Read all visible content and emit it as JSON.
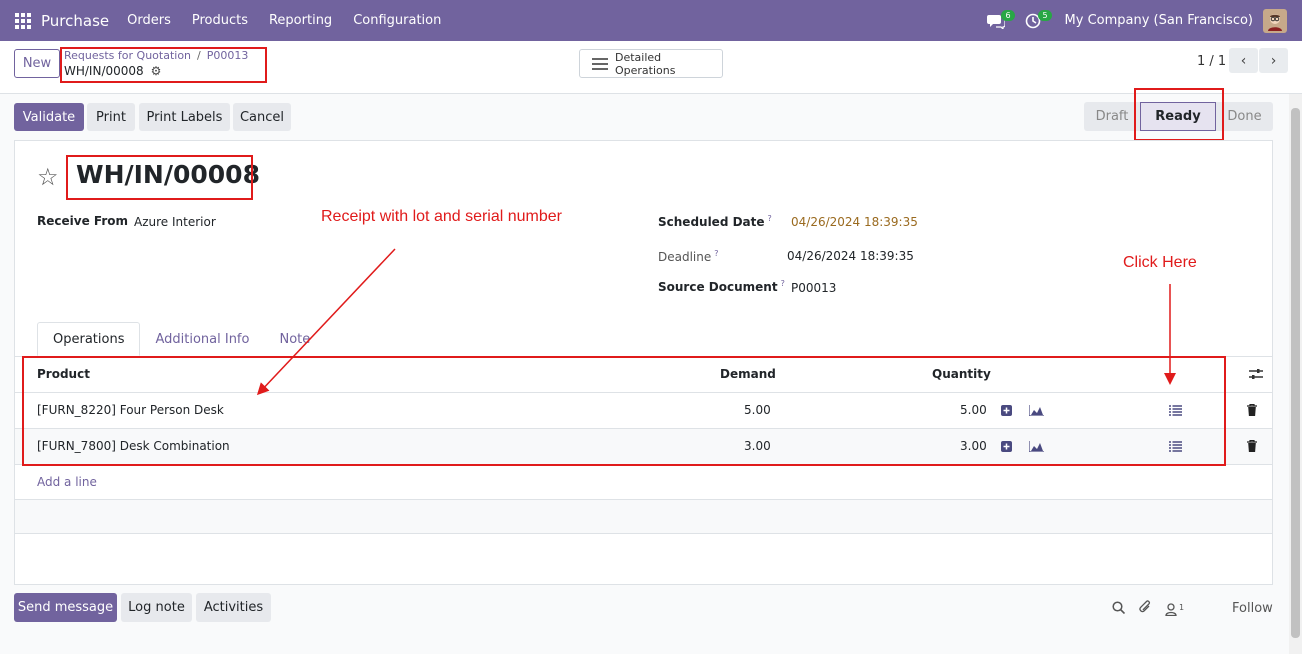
{
  "navbar": {
    "app_name": "Purchase",
    "menu": [
      "Orders",
      "Products",
      "Reporting",
      "Configuration"
    ],
    "messages_badge": "6",
    "activities_badge": "5",
    "company": "My Company (San Francisco)"
  },
  "control": {
    "new_label": "New",
    "breadcrumb_parent": "Requests for Quotation",
    "breadcrumb_sep": "/",
    "breadcrumb_po": "P00013",
    "record_name": "WH/IN/00008",
    "detailed_operations": "Detailed Operations",
    "pager": "1 / 1"
  },
  "actions": {
    "validate": "Validate",
    "print": "Print",
    "print_labels": "Print Labels",
    "cancel": "Cancel"
  },
  "stages": [
    "Draft",
    "Ready",
    "Done"
  ],
  "form": {
    "title": "WH/IN/00008",
    "receive_from_label": "Receive From",
    "receive_from_value": "Azure Interior",
    "scheduled_date_label": "Scheduled Date",
    "scheduled_date_value": "04/26/2024 18:39:35",
    "deadline_label": "Deadline",
    "deadline_value": "04/26/2024 18:39:35",
    "source_document_label": "Source Document",
    "source_document_value": "P00013",
    "help_mark": "?"
  },
  "annotations": {
    "receipt_note": "Receipt  with lot and serial number",
    "click_here": "Click Here"
  },
  "tabs": [
    "Operations",
    "Additional Info",
    "Note"
  ],
  "table": {
    "headers": {
      "product": "Product",
      "demand": "Demand",
      "quantity": "Quantity"
    },
    "rows": [
      {
        "product": "[FURN_8220] Four Person Desk",
        "demand": "5.00",
        "quantity": "5.00"
      },
      {
        "product": "[FURN_7800] Desk Combination",
        "demand": "3.00",
        "quantity": "3.00"
      }
    ],
    "add_line": "Add a line"
  },
  "chatter": {
    "send_message": "Send message",
    "log_note": "Log note",
    "activities": "Activities",
    "followers_count": "1",
    "follow": "Follow"
  },
  "colors": {
    "brand": "#71639e",
    "annotation": "#e01b1b",
    "badge": "#28a745"
  }
}
